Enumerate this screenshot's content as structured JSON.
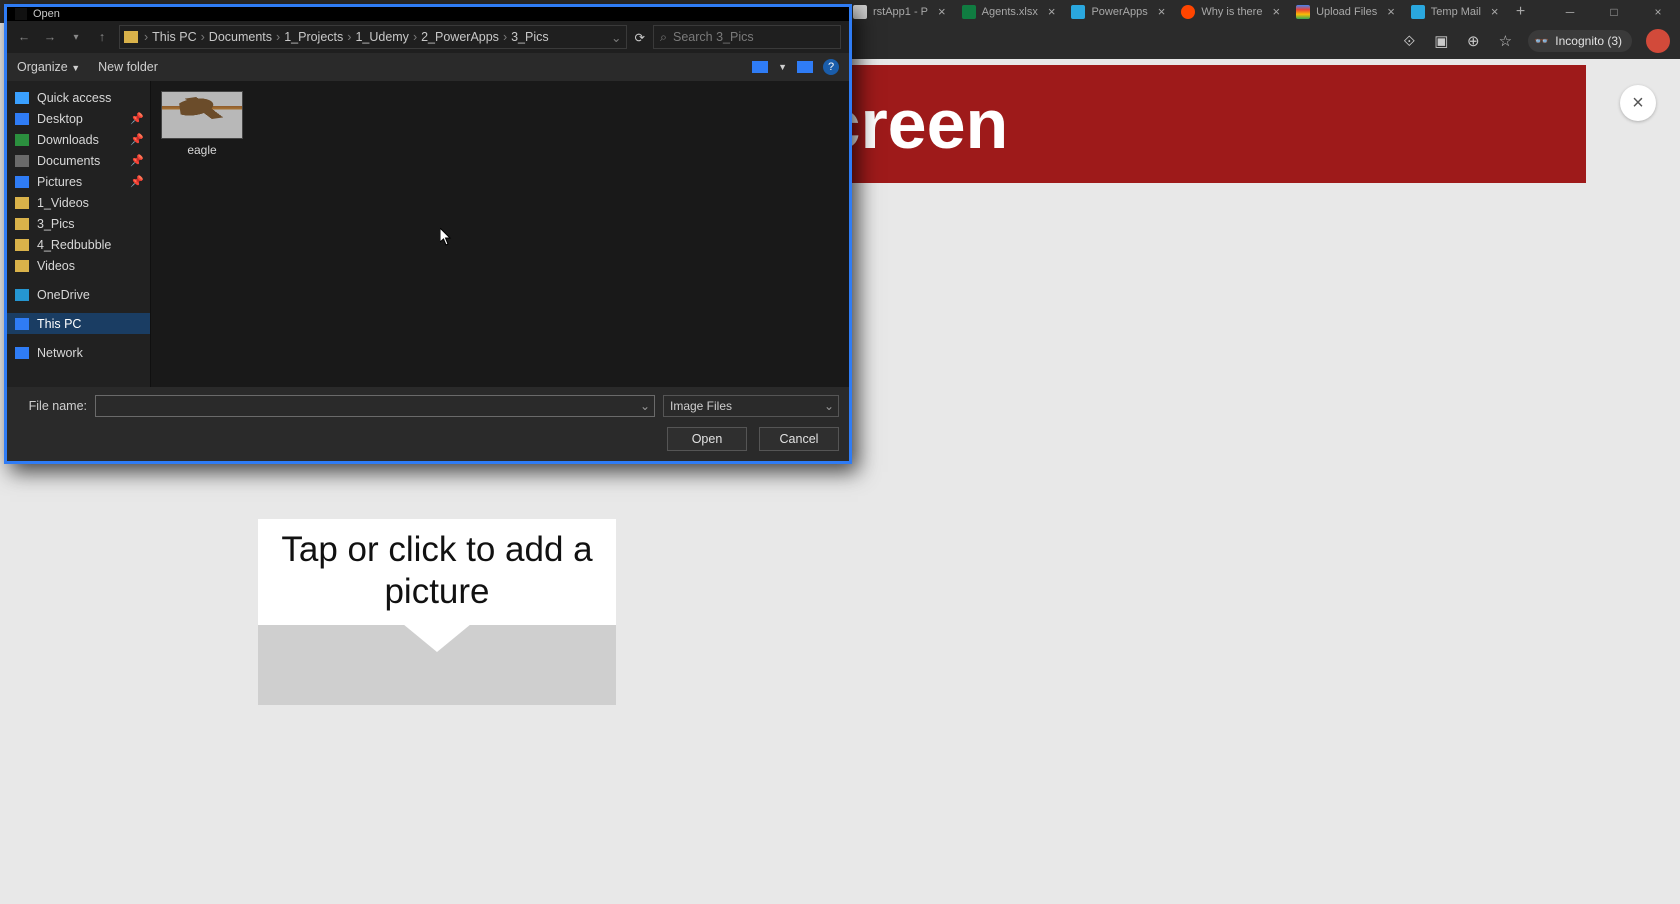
{
  "browser": {
    "tabs": [
      {
        "label": "rstApp1 - P",
        "favicon": "#d0d0d0"
      },
      {
        "label": "Agents.xlsx",
        "favicon": "#107c41"
      },
      {
        "label": "PowerApps",
        "favicon": "#2aa7de"
      },
      {
        "label": "Why is there",
        "favicon": "#ff4500"
      },
      {
        "label": "Upload Files",
        "favicon": "#4285f4"
      },
      {
        "label": "Temp Mail",
        "favicon": "#2aa7de"
      }
    ],
    "incognito_label": "Incognito (3)"
  },
  "page": {
    "banner_text": "he Screen",
    "add_picture_text": "Tap or click to add a picture"
  },
  "dialog": {
    "title": "Open",
    "breadcrumb": [
      "This PC",
      "Documents",
      "1_Projects",
      "1_Udemy",
      "2_PowerApps",
      "3_Pics"
    ],
    "search_placeholder": "Search 3_Pics",
    "organize_label": "Organize",
    "newfolder_label": "New folder",
    "sidebar": {
      "quick_access": "Quick access",
      "desktop": "Desktop",
      "downloads": "Downloads",
      "documents": "Documents",
      "pictures": "Pictures",
      "videos1": "1_Videos",
      "pics3": "3_Pics",
      "redbubble": "4_Redbubble",
      "videos": "Videos",
      "onedrive": "OneDrive",
      "thispc": "This PC",
      "network": "Network"
    },
    "file_label": "eagle",
    "filename_label": "File name:",
    "filter_label": "Image Files",
    "open_btn": "Open",
    "cancel_btn": "Cancel"
  }
}
